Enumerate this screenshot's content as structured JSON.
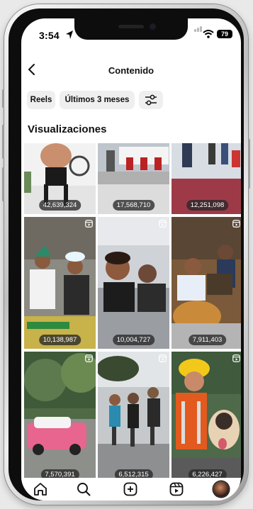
{
  "status_bar": {
    "time": "3:54",
    "battery": "79"
  },
  "header": {
    "title": "Contenido"
  },
  "filters": [
    {
      "label": "Reels"
    },
    {
      "label": "Últimos 3 meses"
    }
  ],
  "section": {
    "title": "Visualizaciones"
  },
  "posts": [
    {
      "views": "42,639,324",
      "reel": false
    },
    {
      "views": "17,568,710",
      "reel": false
    },
    {
      "views": "12,251,098",
      "reel": false
    },
    {
      "views": "10,138,987",
      "reel": true
    },
    {
      "views": "10,004,727",
      "reel": true
    },
    {
      "views": "7,911,403",
      "reel": true
    },
    {
      "views": "7,570,391",
      "reel": true
    },
    {
      "views": "6,512,315",
      "reel": true
    },
    {
      "views": "6,226,427",
      "reel": true
    }
  ],
  "tabbar": {
    "icons": [
      "home-icon",
      "search-icon",
      "create-icon",
      "reels-icon",
      "profile-avatar"
    ]
  }
}
